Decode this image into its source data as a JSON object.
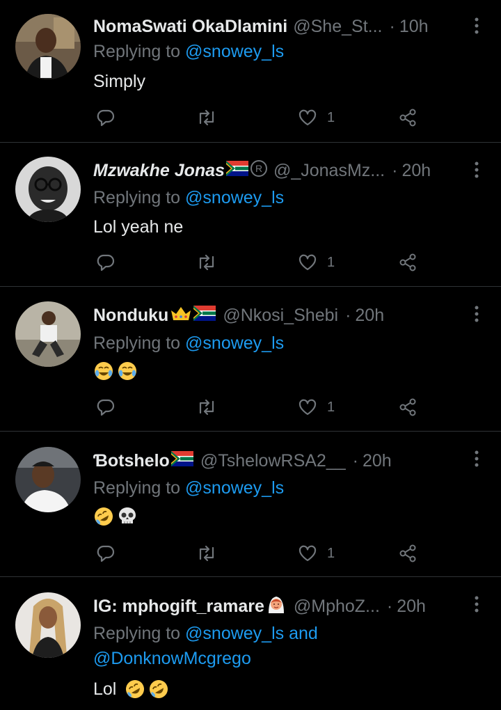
{
  "colors": {
    "background": "#000000",
    "text": "#e7e9ea",
    "muted": "#71767b",
    "accent": "#1d9bf0",
    "divider": "#2f3336"
  },
  "tweets": [
    {
      "name": "NomaSwati OkaDlamini",
      "handle": "@She_St...",
      "time": "10h",
      "replying_label": "Replying to",
      "mentions": [
        "@snowey_ls"
      ],
      "text": "Simply",
      "emojis": [],
      "likes": "1",
      "avatar_icon": "woman-avatar"
    },
    {
      "name": "Mzwakhe Jonas",
      "handle": "@_JonasMz...",
      "time": "20h",
      "replying_label": "Replying to",
      "mentions": [
        "@snowey_ls"
      ],
      "text": "Lol yeah ne",
      "emojis": [],
      "likes": "1",
      "badges": [
        "south-africa-flag",
        "registered-icon"
      ],
      "avatar_icon": "man-glasses-avatar"
    },
    {
      "name": "Nonduku",
      "handle": "@Nkosi_Shebi",
      "time": "20h",
      "replying_label": "Replying to",
      "mentions": [
        "@snowey_ls"
      ],
      "text": "",
      "emojis": [
        "tears-of-joy",
        "tears-of-joy"
      ],
      "likes": "1",
      "badges": [
        "crown-icon",
        "south-africa-flag"
      ],
      "avatar_icon": "man-sitting-avatar"
    },
    {
      "name": "Ɓotshelo",
      "handle": "@TshelowRSA2__",
      "time": "20h",
      "replying_label": "Replying to",
      "mentions": [
        "@snowey_ls"
      ],
      "text": "",
      "emojis": [
        "rolling-on-floor-laughing",
        "skull"
      ],
      "likes": "1",
      "badges": [
        "south-africa-flag"
      ],
      "avatar_icon": "man-car-avatar"
    },
    {
      "name": "IG: mphogift_ramare",
      "handle": "@MphoZ...",
      "time": "20h",
      "replying_label": "Replying to",
      "mentions": [
        "@snowey_ls",
        "@DonknowMcgrego"
      ],
      "mention_joiner": "and",
      "text": "Lol",
      "emojis": [
        "rolling-on-floor-laughing",
        "rolling-on-floor-laughing"
      ],
      "badges": [
        "bride-emoji"
      ],
      "avatar_icon": "woman-braids-avatar"
    }
  ]
}
